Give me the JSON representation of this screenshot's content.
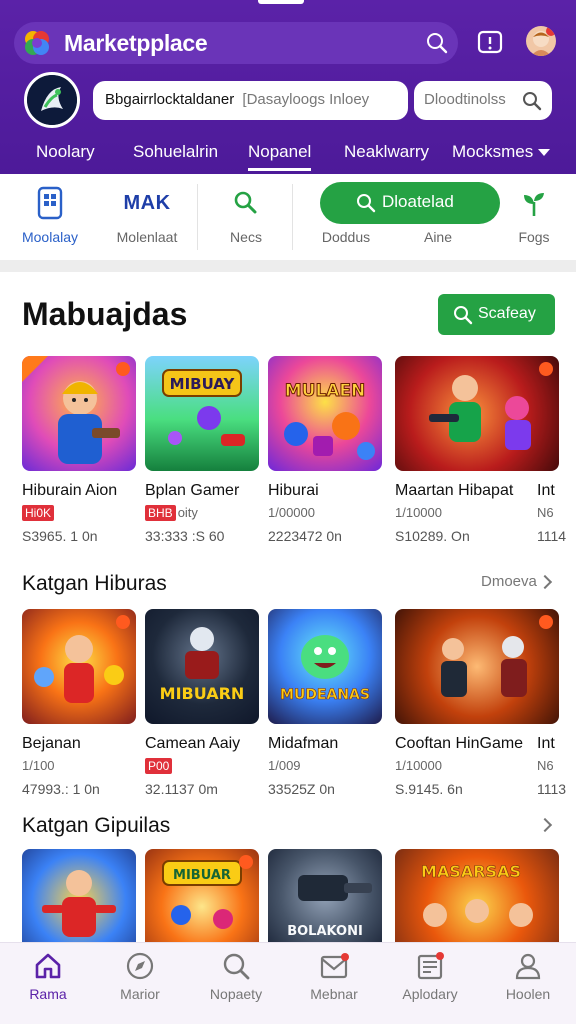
{
  "header": {
    "app_title": "Marketpplace",
    "search_value": "Bbgairrlocktaldaner",
    "search_placeholder": "[Dasayloogs Inloey",
    "secondary_search_placeholder": "Dloodtinolss",
    "nav_tabs": [
      {
        "label": "Noolary",
        "active": false
      },
      {
        "label": "Sohuelalrin",
        "active": false
      },
      {
        "label": "Nopanel",
        "active": true
      },
      {
        "label": "Neaklwarry",
        "active": false
      },
      {
        "label": "Mocksmes",
        "active": false,
        "has_dropdown": true
      }
    ]
  },
  "categories": [
    {
      "label": "Moolalay",
      "icon": "phone-grid-icon",
      "active": true
    },
    {
      "label": "Molenlaat",
      "icon": "mak-logo",
      "logo_text": "MAK",
      "active": false
    },
    {
      "label": "Necs",
      "icon": "search-icon",
      "active": false
    },
    {
      "label": "Doddus",
      "icon": "none",
      "active": false
    },
    {
      "label": "Aine",
      "icon": "none",
      "active": false
    },
    {
      "label": "Fogs",
      "icon": "sprout-icon",
      "active": false
    }
  ],
  "download_button": {
    "label": "Dloatelad"
  },
  "sections": [
    {
      "title": "Mabuajdas",
      "action_label": "Scafeay",
      "items": [
        {
          "title": "Hiburain Aion",
          "sub": "",
          "badge": "Hi0K",
          "price": "S3965. 1 0n",
          "art": "worker-hero"
        },
        {
          "title": "Bplan Gamer",
          "sub": "oity",
          "badge": "BHB",
          "price": "33:333 :S 60",
          "art": "mibuay-meadow"
        },
        {
          "title": "Hiburai",
          "sub": "1/00000",
          "badge": "",
          "price": "2223472 0n",
          "art": "mulaen-arena"
        },
        {
          "title": "Maartan Hibapat",
          "sub": "1/10000",
          "badge": "",
          "price": "S10289. On",
          "art": "hammer-brawl"
        },
        {
          "title": "Int",
          "sub": "N6",
          "badge": "",
          "price": "1114",
          "art": "cut"
        }
      ]
    },
    {
      "title": "Katgan Hiburas",
      "action_label": "Dmoeva",
      "items": [
        {
          "title": "Bejanan",
          "sub": "1/100",
          "badge": "",
          "price": "47993.: 1 0n",
          "art": "hero-squad"
        },
        {
          "title": "Camean Aaiy",
          "sub": "",
          "badge": "P00",
          "price": "32.1137 0m",
          "art": "mibuarn-knight"
        },
        {
          "title": "Midafman",
          "sub": "1/009",
          "badge": "",
          "price": "33525Z 0n",
          "art": "mudeanas-dragon"
        },
        {
          "title": "Cooftan HinGame",
          "sub": "1/10000",
          "badge": "",
          "price": "S.9145. 6n",
          "art": "street-fighters"
        },
        {
          "title": "Int",
          "sub": "N6",
          "badge": "",
          "price": "1113",
          "art": "cut"
        }
      ]
    },
    {
      "title": "Katgan Gipuilas",
      "action_label": "",
      "items": [
        {
          "art": "red-hero"
        },
        {
          "art": "mibuar-racers"
        },
        {
          "art": "bolakoni-turret"
        },
        {
          "art": "masarsas-crew"
        }
      ]
    }
  ],
  "bottom_nav": [
    {
      "label": "Rama",
      "icon": "home-icon",
      "active": true
    },
    {
      "label": "Marior",
      "icon": "compass-icon",
      "active": false
    },
    {
      "label": "Nopaety",
      "icon": "search-icon",
      "active": false
    },
    {
      "label": "Mebnar",
      "icon": "mail-icon",
      "active": false
    },
    {
      "label": "Aplodary",
      "icon": "store-icon",
      "active": false
    },
    {
      "label": "Hoolen",
      "icon": "user-icon",
      "active": false
    }
  ],
  "art_captions": {
    "mibuay": "MIBUAY",
    "mulaen": "MULAEN",
    "mibuarn": "MIBUARN",
    "mudeanas": "MUDEANAS",
    "mibuar": "MIBUAR",
    "bolakoni": "BOLAKONI",
    "masarsas": "MASARSAS"
  },
  "colors": {
    "header": "#5b22a8",
    "accent_green": "#25a244",
    "badge_red": "#e0303a",
    "active_blue": "#2a60c8"
  }
}
